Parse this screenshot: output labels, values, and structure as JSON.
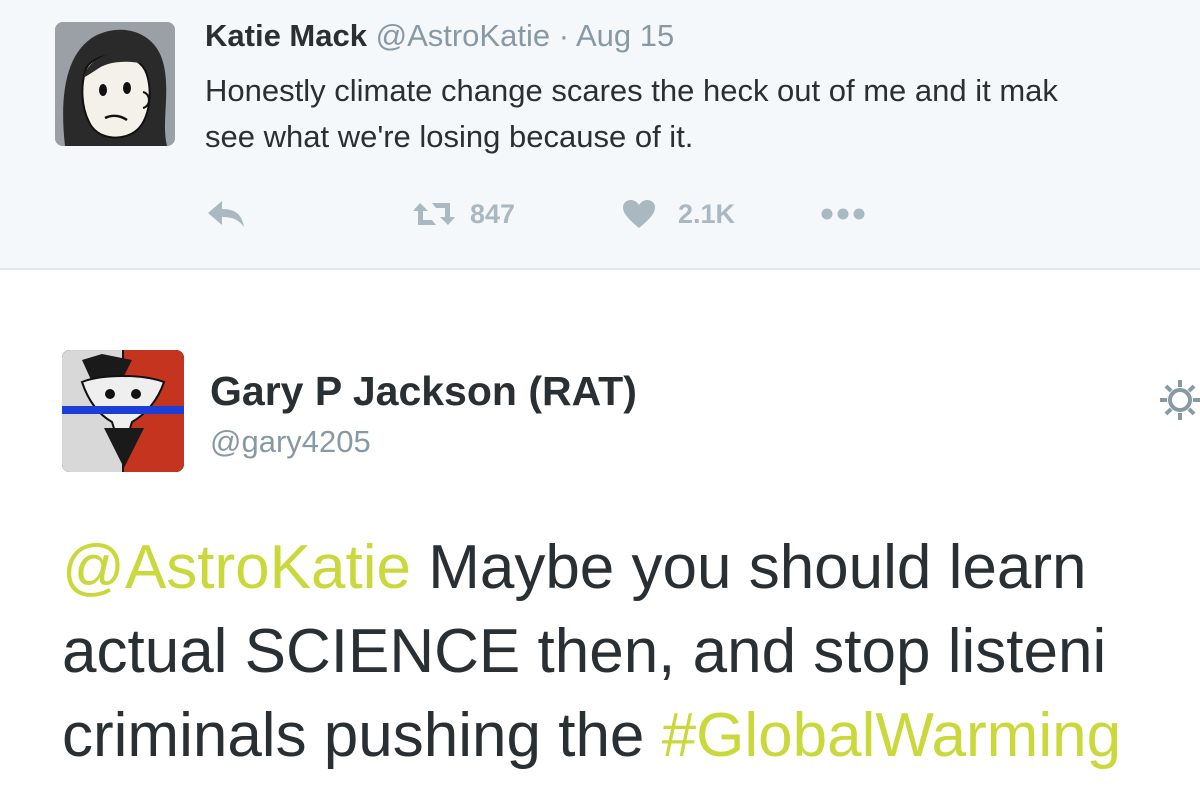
{
  "parent_tweet": {
    "author_name": "Katie Mack",
    "handle": "@AstroKatie",
    "separator": "·",
    "date": "Aug 15",
    "text_line1": "Honestly climate change scares the heck out of me and it mak",
    "text_line2": "see what we're losing because of it.",
    "retweet_count": "847",
    "like_count": "2.1K"
  },
  "reply_tweet": {
    "author_name": "Gary P Jackson (RAT)",
    "handle": "@gary4205",
    "mention": "@AstroKatie",
    "line1_rest": " Maybe you should learn",
    "line2": "actual SCIENCE then, and stop listeni",
    "line3_start": "criminals pushing the ",
    "hashtag": "#GlobalWarming"
  },
  "icons": [
    "reply-icon",
    "retweet-icon",
    "heart-icon",
    "more-icon",
    "gear-icon"
  ],
  "colors": {
    "parent_bg": "#f5f8fa",
    "text": "#292f33",
    "muted": "#8899a6",
    "action_icon": "#aab8c2",
    "link_highlight": "#c9d93c"
  }
}
